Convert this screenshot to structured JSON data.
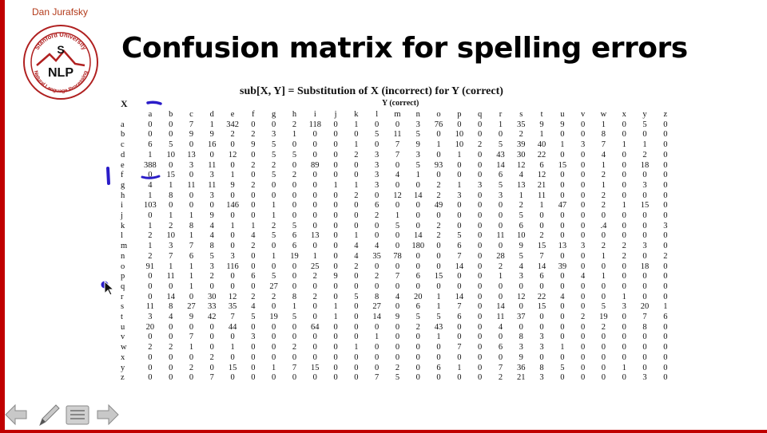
{
  "author": "Dan Jurafsky",
  "logo": {
    "ring_top": "Stanford University",
    "ring_bottom": "Natural Language Processing",
    "line1": "S",
    "line2": "NLP"
  },
  "title": "Confusion matrix for spelling errors",
  "table": {
    "caption": "sub[X, Y] = Substitution of X (incorrect) for Y (correct)",
    "x_axis_label": "X",
    "y_axis_label": "Y (correct)",
    "columns": [
      "a",
      "b",
      "c",
      "d",
      "e",
      "f",
      "g",
      "h",
      "i",
      "j",
      "k",
      "l",
      "m",
      "n",
      "o",
      "p",
      "q",
      "r",
      "s",
      "t",
      "u",
      "v",
      "w",
      "x",
      "y",
      "z"
    ],
    "rows": [
      {
        "label": "a",
        "values": [
          "0",
          "0",
          "7",
          "1",
          "342",
          "0",
          "0",
          "2",
          "118",
          "0",
          "1",
          "0",
          "0",
          "3",
          "76",
          "0",
          "0",
          "1",
          "35",
          "9",
          "9",
          "0",
          "1",
          "0",
          "5",
          "0"
        ]
      },
      {
        "label": "b",
        "values": [
          "0",
          "0",
          "9",
          "9",
          "2",
          "2",
          "3",
          "1",
          "0",
          "0",
          "0",
          "5",
          "11",
          "5",
          "0",
          "10",
          "0",
          "0",
          "2",
          "1",
          "0",
          "0",
          "8",
          "0",
          "0",
          "0"
        ]
      },
      {
        "label": "c",
        "values": [
          "6",
          "5",
          "0",
          "16",
          "0",
          "9",
          "5",
          "0",
          "0",
          "0",
          "1",
          "0",
          "7",
          "9",
          "1",
          "10",
          "2",
          "5",
          "39",
          "40",
          "1",
          "3",
          "7",
          "1",
          "1",
          "0"
        ]
      },
      {
        "label": "d",
        "values": [
          "1",
          "10",
          "13",
          "0",
          "12",
          "0",
          "5",
          "5",
          "0",
          "0",
          "2",
          "3",
          "7",
          "3",
          "0",
          "1",
          "0",
          "43",
          "30",
          "22",
          "0",
          "0",
          "4",
          "0",
          "2",
          "0"
        ]
      },
      {
        "label": "e",
        "values": [
          "388",
          "0",
          "3",
          "11",
          "0",
          "2",
          "2",
          "0",
          "89",
          "0",
          "0",
          "3",
          "0",
          "5",
          "93",
          "0",
          "0",
          "14",
          "12",
          "6",
          "15",
          "0",
          "1",
          "0",
          "18",
          "0"
        ]
      },
      {
        "label": "f",
        "values": [
          "0",
          "15",
          "0",
          "3",
          "1",
          "0",
          "5",
          "2",
          "0",
          "0",
          "0",
          "3",
          "4",
          "1",
          "0",
          "0",
          "0",
          "6",
          "4",
          "12",
          "0",
          "0",
          "2",
          "0",
          "0",
          "0"
        ]
      },
      {
        "label": "g",
        "values": [
          "4",
          "1",
          "11",
          "11",
          "9",
          "2",
          "0",
          "0",
          "0",
          "1",
          "1",
          "3",
          "0",
          "0",
          "2",
          "1",
          "3",
          "5",
          "13",
          "21",
          "0",
          "0",
          "1",
          "0",
          "3",
          "0"
        ]
      },
      {
        "label": "h",
        "values": [
          "1",
          "8",
          "0",
          "3",
          "0",
          "0",
          "0",
          "0",
          "0",
          "0",
          "2",
          "0",
          "12",
          "14",
          "2",
          "3",
          "0",
          "3",
          "1",
          "11",
          "0",
          "0",
          "2",
          "0",
          "0",
          "0"
        ]
      },
      {
        "label": "i",
        "values": [
          "103",
          "0",
          "0",
          "0",
          "146",
          "0",
          "1",
          "0",
          "0",
          "0",
          "0",
          "6",
          "0",
          "0",
          "49",
          "0",
          "0",
          "0",
          "2",
          "1",
          "47",
          "0",
          "2",
          "1",
          "15",
          "0"
        ]
      },
      {
        "label": "j",
        "values": [
          "0",
          "1",
          "1",
          "9",
          "0",
          "0",
          "1",
          "0",
          "0",
          "0",
          "0",
          "2",
          "1",
          "0",
          "0",
          "0",
          "0",
          "0",
          "5",
          "0",
          "0",
          "0",
          "0",
          "0",
          "0",
          "0"
        ]
      },
      {
        "label": "k",
        "values": [
          "1",
          "2",
          "8",
          "4",
          "1",
          "1",
          "2",
          "5",
          "0",
          "0",
          "0",
          "0",
          "5",
          "0",
          "2",
          "0",
          "0",
          "0",
          "6",
          "0",
          "0",
          "0",
          ".4",
          "0",
          "0",
          "3"
        ]
      },
      {
        "label": "l",
        "values": [
          "2",
          "10",
          "1",
          "4",
          "0",
          "4",
          "5",
          "6",
          "13",
          "0",
          "1",
          "0",
          "0",
          "14",
          "2",
          "5",
          "0",
          "11",
          "10",
          "2",
          "0",
          "0",
          "0",
          "0",
          "0",
          "0"
        ]
      },
      {
        "label": "m",
        "values": [
          "1",
          "3",
          "7",
          "8",
          "0",
          "2",
          "0",
          "6",
          "0",
          "0",
          "4",
          "4",
          "0",
          "180",
          "0",
          "6",
          "0",
          "0",
          "9",
          "15",
          "13",
          "3",
          "2",
          "2",
          "3",
          "0"
        ]
      },
      {
        "label": "n",
        "values": [
          "2",
          "7",
          "6",
          "5",
          "3",
          "0",
          "1",
          "19",
          "1",
          "0",
          "4",
          "35",
          "78",
          "0",
          "0",
          "7",
          "0",
          "28",
          "5",
          "7",
          "0",
          "0",
          "1",
          "2",
          "0",
          "2"
        ]
      },
      {
        "label": "o",
        "values": [
          "91",
          "1",
          "1",
          "3",
          "116",
          "0",
          "0",
          "0",
          "25",
          "0",
          "2",
          "0",
          "0",
          "0",
          "0",
          "14",
          "0",
          "2",
          "4",
          "14",
          "39",
          "0",
          "0",
          "0",
          "18",
          "0"
        ]
      },
      {
        "label": "p",
        "values": [
          "0",
          "11",
          "1",
          "2",
          "0",
          "6",
          "5",
          "0",
          "2",
          "9",
          "0",
          "2",
          "7",
          "6",
          "15",
          "0",
          "0",
          "1",
          "3",
          "6",
          "0",
          "4",
          "1",
          "0",
          "0",
          "0"
        ]
      },
      {
        "label": "q",
        "values": [
          "0",
          "0",
          "1",
          "0",
          "0",
          "0",
          "27",
          "0",
          "0",
          "0",
          "0",
          "0",
          "0",
          "0",
          "0",
          "0",
          "0",
          "0",
          "0",
          "0",
          "0",
          "0",
          "0",
          "0",
          "0",
          "0"
        ]
      },
      {
        "label": "r",
        "values": [
          "0",
          "14",
          "0",
          "30",
          "12",
          "2",
          "2",
          "8",
          "2",
          "0",
          "5",
          "8",
          "4",
          "20",
          "1",
          "14",
          "0",
          "0",
          "12",
          "22",
          "4",
          "0",
          "0",
          "1",
          "0",
          "0"
        ]
      },
      {
        "label": "s",
        "values": [
          "11",
          "8",
          "27",
          "33",
          "35",
          "4",
          "0",
          "1",
          "0",
          "1",
          "0",
          "27",
          "0",
          "6",
          "1",
          "7",
          "0",
          "14",
          "0",
          "15",
          "0",
          "0",
          "5",
          "3",
          "20",
          "1"
        ]
      },
      {
        "label": "t",
        "values": [
          "3",
          "4",
          "9",
          "42",
          "7",
          "5",
          "19",
          "5",
          "0",
          "1",
          "0",
          "14",
          "9",
          "5",
          "5",
          "6",
          "0",
          "11",
          "37",
          "0",
          "0",
          "2",
          "19",
          "0",
          "7",
          "6"
        ]
      },
      {
        "label": "u",
        "values": [
          "20",
          "0",
          "0",
          "0",
          "44",
          "0",
          "0",
          "0",
          "64",
          "0",
          "0",
          "0",
          "0",
          "2",
          "43",
          "0",
          "0",
          "4",
          "0",
          "0",
          "0",
          "0",
          "2",
          "0",
          "8",
          "0"
        ]
      },
      {
        "label": "v",
        "values": [
          "0",
          "0",
          "7",
          "0",
          "0",
          "3",
          "0",
          "0",
          "0",
          "0",
          "0",
          "1",
          "0",
          "0",
          "1",
          "0",
          "0",
          "0",
          "8",
          "3",
          "0",
          "0",
          "0",
          "0",
          "0",
          "0"
        ]
      },
      {
        "label": "w",
        "values": [
          "2",
          "2",
          "1",
          "0",
          "1",
          "0",
          "0",
          "2",
          "0",
          "0",
          "1",
          "0",
          "0",
          "0",
          "0",
          "7",
          "0",
          "6",
          "3",
          "3",
          "1",
          "0",
          "0",
          "0",
          "0",
          "0"
        ]
      },
      {
        "label": "x",
        "values": [
          "0",
          "0",
          "0",
          "2",
          "0",
          "0",
          "0",
          "0",
          "0",
          "0",
          "0",
          "0",
          "0",
          "0",
          "0",
          "0",
          "0",
          "0",
          "9",
          "0",
          "0",
          "0",
          "0",
          "0",
          "0",
          "0"
        ]
      },
      {
        "label": "y",
        "values": [
          "0",
          "0",
          "2",
          "0",
          "15",
          "0",
          "1",
          "7",
          "15",
          "0",
          "0",
          "0",
          "2",
          "0",
          "6",
          "1",
          "0",
          "7",
          "36",
          "8",
          "5",
          "0",
          "0",
          "1",
          "0",
          "0"
        ]
      },
      {
        "label": "z",
        "values": [
          "0",
          "0",
          "0",
          "7",
          "0",
          "0",
          "0",
          "0",
          "0",
          "0",
          "0",
          "7",
          "5",
          "0",
          "0",
          "0",
          "0",
          "2",
          "21",
          "3",
          "0",
          "0",
          "0",
          "0",
          "3",
          "0"
        ]
      }
    ]
  },
  "colors": {
    "accent": "#c00000",
    "annotation": "#2a1cc8",
    "author_text": "#b33a1a"
  },
  "navigation": [
    "previous-slide",
    "pen-tool",
    "slide-menu",
    "next-slide"
  ]
}
